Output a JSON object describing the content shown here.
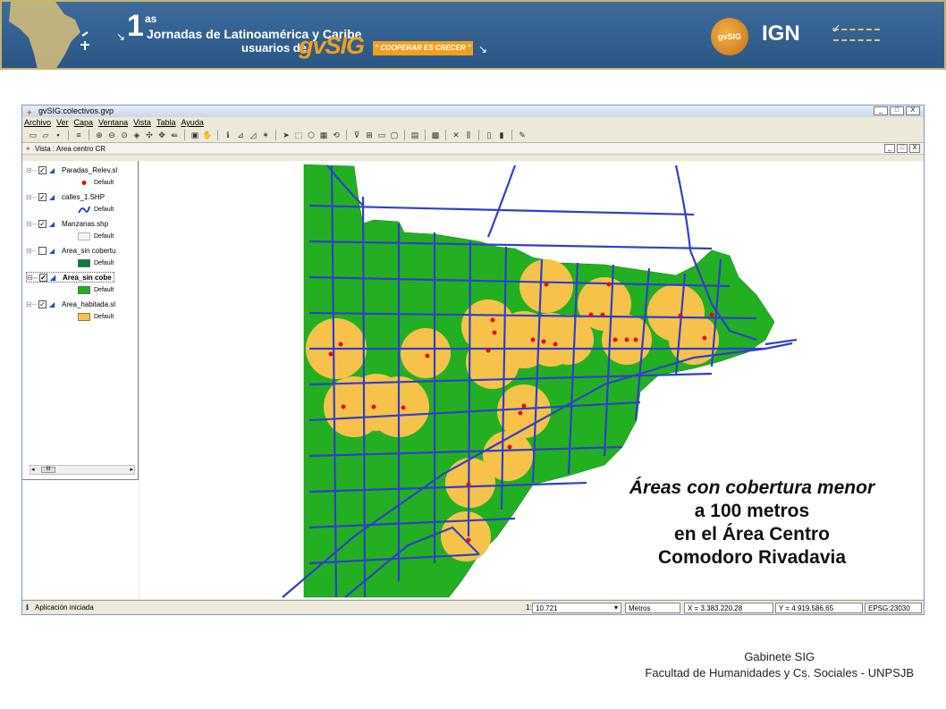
{
  "banner": {
    "number": "1",
    "superscript": "as",
    "line1": "Jornadas de Latinoamérica y Caribe",
    "line2": "usuarios de",
    "brand": "gvSIG",
    "slogan": "\" COOPERAR ES CRECER \"",
    "logo1": "gvSIG",
    "logo2": "IGN"
  },
  "window": {
    "title": "gvSIG:colectivos.gvp",
    "controls": [
      "_",
      "□",
      "X"
    ]
  },
  "menu": [
    "Archivo",
    "Ver",
    "Capa",
    "Ventana",
    "Vista",
    "Tabla",
    "Ayuda"
  ],
  "view": {
    "title": "Vista : Area centro CR",
    "controls": [
      "_",
      "□",
      "X"
    ]
  },
  "toc": {
    "layers": [
      {
        "name": "Paradas_Relev.sl",
        "checked": true,
        "legend": "Default",
        "symbol": "point"
      },
      {
        "name": "calles_1.SHP",
        "checked": true,
        "legend": "Default",
        "symbol": "line"
      },
      {
        "name": "Manzanas.shp",
        "checked": true,
        "legend": "Default",
        "symbol": "empty"
      },
      {
        "name": "Area_sin cobertu",
        "checked": false,
        "legend": "Default",
        "symbol": "darkgreen"
      },
      {
        "name": "Area_sin cobe",
        "checked": true,
        "legend": "Default",
        "symbol": "green",
        "selected": true
      },
      {
        "name": "Area_habitada.sl",
        "checked": true,
        "legend": "Default",
        "symbol": "orange"
      }
    ],
    "scroll_label": "III"
  },
  "status": {
    "message": "Aplicación iniciada",
    "scale_prefix": "1:",
    "scale": "10.721",
    "units": "Metros",
    "x": "X = 3.383.220,28",
    "y": "Y = 4.919.586,65",
    "epsg": "EPSG:23030"
  },
  "overlay": {
    "line1": "Áreas con cobertura menor",
    "line2": "a 100 metros",
    "line3": "en el Área Centro",
    "line4": "Comodoro Rivadavia"
  },
  "footer": {
    "line1": "Gabinete SIG",
    "line2": "Facultad de Humanidades y Cs. Sociales - UNPSJB"
  },
  "colors": {
    "green": "#22b022",
    "orange": "#f7c24a",
    "street": "#3040c8",
    "stop": "#e01010"
  }
}
